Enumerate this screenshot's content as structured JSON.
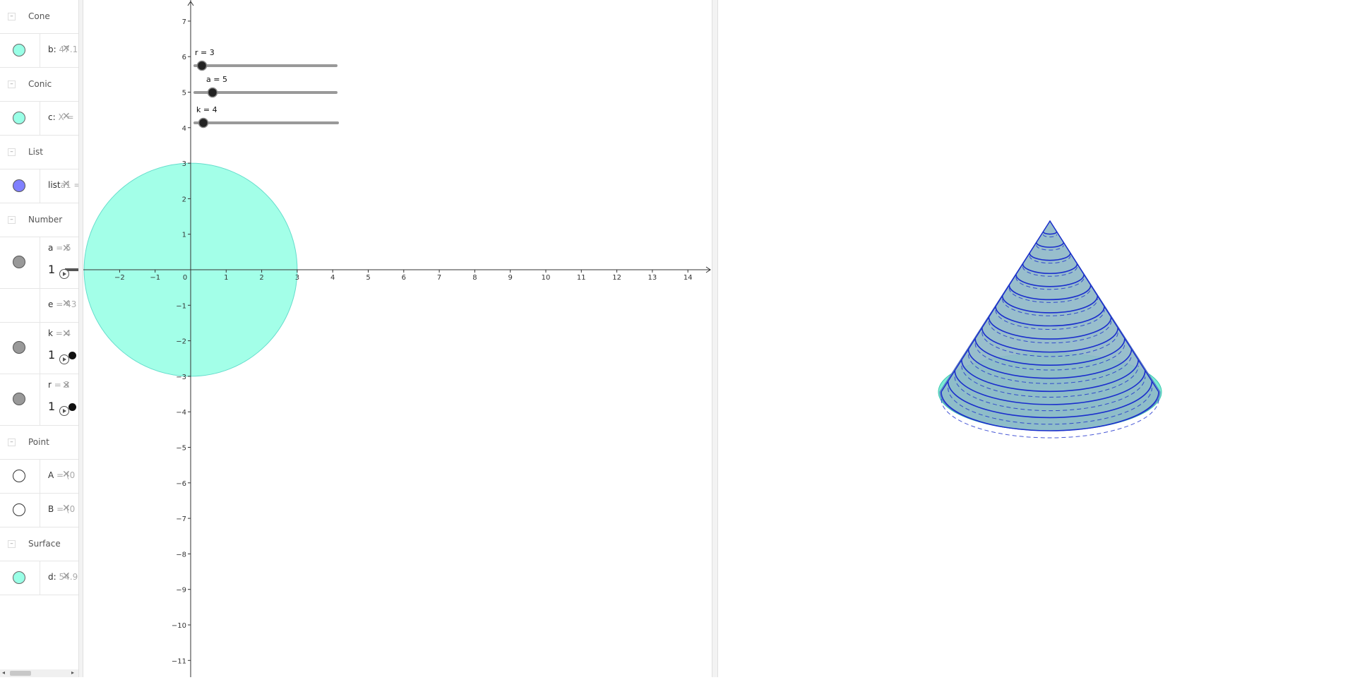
{
  "algebra": {
    "groups": [
      {
        "label": "Cone",
        "items": [
          {
            "name": "b:",
            "value": "47.1:",
            "color": "#99ffe6"
          }
        ]
      },
      {
        "label": "Conic",
        "items": [
          {
            "name": "c:",
            "value": "X =",
            "color": "#99ffe6"
          }
        ]
      },
      {
        "label": "List",
        "items": [
          {
            "name": "list",
            "value": "a1 =",
            "color": "#8080ff"
          }
        ]
      },
      {
        "label": "Number",
        "items": [
          {
            "name": "a",
            "value": "= 5",
            "color": "#999999",
            "slider_value": "1"
          },
          {
            "name": "e",
            "value": "= 43"
          },
          {
            "name": "k",
            "value": "= 4",
            "color": "#999999",
            "slider_value": "1"
          },
          {
            "name": "r",
            "value": "= 3",
            "color": "#999999",
            "slider_value": "1"
          }
        ]
      },
      {
        "label": "Point",
        "items": [
          {
            "name": "A",
            "value": "= (0",
            "color": "#ffffff"
          },
          {
            "name": "B",
            "value": "= (0",
            "color": "#ffffff"
          }
        ]
      },
      {
        "label": "Surface",
        "items": [
          {
            "name": "d:",
            "value": "54.9",
            "color": "#99ffe6"
          }
        ]
      }
    ],
    "delete_glyph": "✕",
    "collapse_glyph": "–",
    "scroll_left": "◂",
    "scroll_right": "▸"
  },
  "graphics": {
    "sliders": [
      {
        "label": "r = 3",
        "value": 3,
        "min": 0,
        "max": 10
      },
      {
        "label": "a = 5",
        "value": 5,
        "min": 0,
        "max": 10
      },
      {
        "label": "k = 4",
        "value": 4,
        "min": 0,
        "max": 10
      }
    ],
    "x_ticks": [
      "−2",
      "−1",
      "0",
      "1",
      "2",
      "3",
      "4",
      "5",
      "6",
      "7",
      "8",
      "9",
      "10",
      "11",
      "12",
      "13",
      "14"
    ],
    "y_ticks": [
      "7",
      "6",
      "5",
      "4",
      "3",
      "2",
      "1",
      "0",
      "−1",
      "−2",
      "−3",
      "−4",
      "−5",
      "−6",
      "−7",
      "−8",
      "−9",
      "−10",
      "−11"
    ],
    "circle": {
      "center_x": 0,
      "center_y": 0,
      "radius": 3,
      "fill": "#99ffe6",
      "stroke": "#66ddcc"
    },
    "axes_color": "#333333"
  },
  "view3d": {
    "cone": {
      "radius": 3,
      "height": 5,
      "rings": 16,
      "fill": "#8fb8c8",
      "ring_color": "#1a2ecc",
      "base_color": "#66e6cc"
    }
  }
}
